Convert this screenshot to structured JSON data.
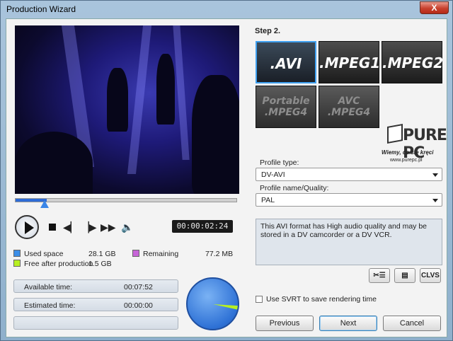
{
  "window": {
    "title": "Production Wizard",
    "close_label": "X"
  },
  "playback": {
    "timecode": "00:00:02:24",
    "position": 0.14
  },
  "storage": {
    "used_label": "Used space",
    "used_value": "28.1  GB",
    "free_label": "Free after production",
    "free_value": "1.5  GB",
    "remaining_label": "Remaining",
    "remaining_value": "77.2  MB",
    "colors": {
      "used": "#3b8ee8",
      "free": "#b7f021",
      "remaining": "#c765d8"
    }
  },
  "times": {
    "available_label": "Available time:",
    "available_value": "00:07:52",
    "estimated_label": "Estimated time:",
    "estimated_value": "00:00:00"
  },
  "step": {
    "label": "Step 2."
  },
  "formats": [
    {
      "line1": ".AVI",
      "line2": ""
    },
    {
      "line1": ".MPEG1",
      "line2": ""
    },
    {
      "line1": ".MPEG2",
      "line2": ""
    },
    {
      "line1": "Portable",
      "line2": ".MPEG4"
    },
    {
      "line1": "AVC",
      "line2": ".MPEG4"
    }
  ],
  "watermark": {
    "text": "PURE PC",
    "slogan": "Wiemy, co się kręci",
    "url": "www.purepc.pl"
  },
  "profile": {
    "type_label": "Profile type:",
    "type_value": "DV-AVI",
    "quality_label": "Profile name/Quality:",
    "quality_value": "PAL",
    "description": "This AVI format has High audio quality and may be stored in a DV camcorder or a DV VCR."
  },
  "small_buttons": {
    "clvs": "CLVS"
  },
  "svrt": {
    "label": "Use SVRT to save rendering time"
  },
  "nav": {
    "previous": "Previous",
    "next": "Next",
    "cancel": "Cancel"
  }
}
